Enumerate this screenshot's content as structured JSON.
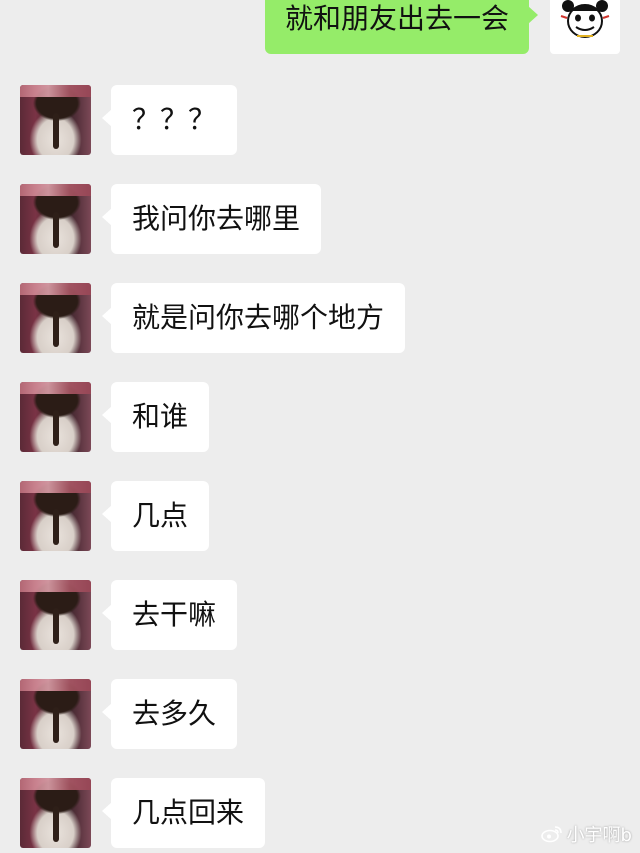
{
  "outgoing": {
    "text": "就和朋友出去一会"
  },
  "incoming": [
    {
      "text": "？？？"
    },
    {
      "text": "我问你去哪里"
    },
    {
      "text": "就是问你去哪个地方"
    },
    {
      "text": "和谁"
    },
    {
      "text": "几点"
    },
    {
      "text": "去干嘛"
    },
    {
      "text": "去多久"
    },
    {
      "text": "几点回来"
    }
  ],
  "watermark": {
    "text": "小宇啊b",
    "icon": "weibo-icon"
  },
  "colors": {
    "background": "#ededed",
    "outgoing_bubble": "#95ec69",
    "incoming_bubble": "#ffffff"
  }
}
